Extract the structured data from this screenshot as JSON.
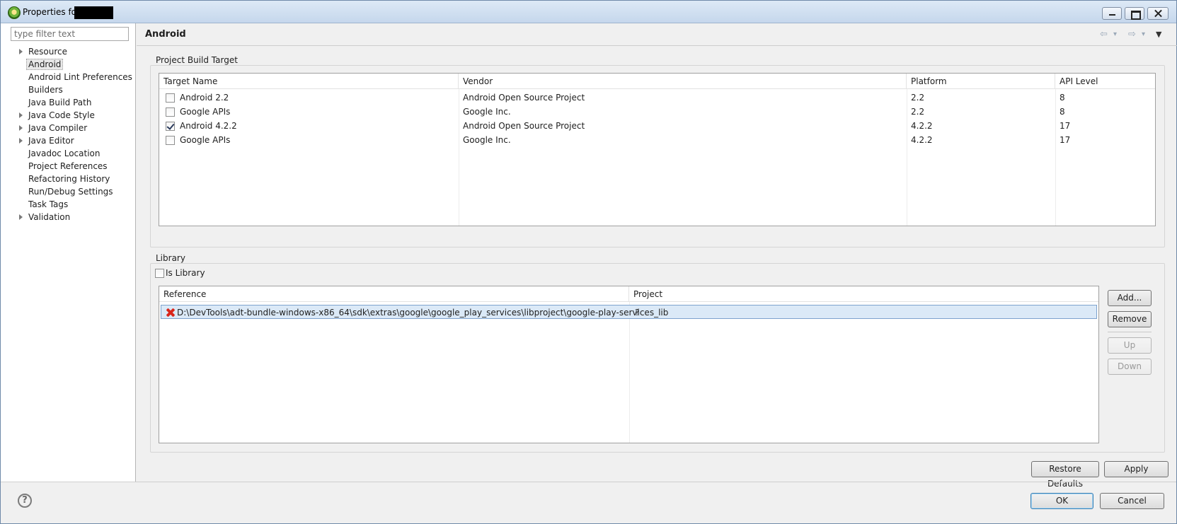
{
  "window": {
    "title": "Properties for"
  },
  "filter": {
    "placeholder": "type filter text"
  },
  "tree": {
    "items": [
      {
        "label": "Resource",
        "expandable": true
      },
      {
        "label": "Android",
        "expandable": false,
        "selected": true
      },
      {
        "label": "Android Lint Preferences",
        "expandable": false
      },
      {
        "label": "Builders",
        "expandable": false
      },
      {
        "label": "Java Build Path",
        "expandable": false
      },
      {
        "label": "Java Code Style",
        "expandable": true
      },
      {
        "label": "Java Compiler",
        "expandable": true
      },
      {
        "label": "Java Editor",
        "expandable": true
      },
      {
        "label": "Javadoc Location",
        "expandable": false
      },
      {
        "label": "Project References",
        "expandable": false
      },
      {
        "label": "Refactoring History",
        "expandable": false
      },
      {
        "label": "Run/Debug Settings",
        "expandable": false
      },
      {
        "label": "Task Tags",
        "expandable": false
      },
      {
        "label": "Validation",
        "expandable": true
      }
    ]
  },
  "page": {
    "title": "Android"
  },
  "build_target": {
    "group_label": "Project Build Target",
    "columns": [
      "Target Name",
      "Vendor",
      "Platform",
      "API Level"
    ],
    "rows": [
      {
        "name": "Android 2.2",
        "vendor": "Android Open Source Project",
        "platform": "2.2",
        "api": "8",
        "checked": false
      },
      {
        "name": "Google APIs",
        "vendor": "Google Inc.",
        "platform": "2.2",
        "api": "8",
        "checked": false
      },
      {
        "name": "Android 4.2.2",
        "vendor": "Android Open Source Project",
        "platform": "4.2.2",
        "api": "17",
        "checked": true
      },
      {
        "name": "Google APIs",
        "vendor": "Google Inc.",
        "platform": "4.2.2",
        "api": "17",
        "checked": false
      }
    ]
  },
  "library": {
    "group_label": "Library",
    "is_library_label": "Is Library",
    "is_library_checked": false,
    "columns": [
      "Reference",
      "Project"
    ],
    "rows": [
      {
        "reference": "D:\\DevTools\\adt-bundle-windows-x86_64\\sdk\\extras\\google\\google_play_services\\libproject\\google-play-services_lib",
        "project": "?",
        "status": "error"
      }
    ],
    "buttons": {
      "add": "Add...",
      "remove": "Remove",
      "up": "Up",
      "down": "Down"
    }
  },
  "actions": {
    "restore_defaults": "Restore Defaults",
    "apply": "Apply",
    "ok": "OK",
    "cancel": "Cancel"
  },
  "icons": {
    "help": "?",
    "back": "⇦",
    "forward": "⇨",
    "menu": "▼",
    "small_menu": "▾"
  },
  "colors": {
    "selection": "#dbe9f7",
    "error": "#d9261c",
    "title_bar": "#dde9f6"
  }
}
